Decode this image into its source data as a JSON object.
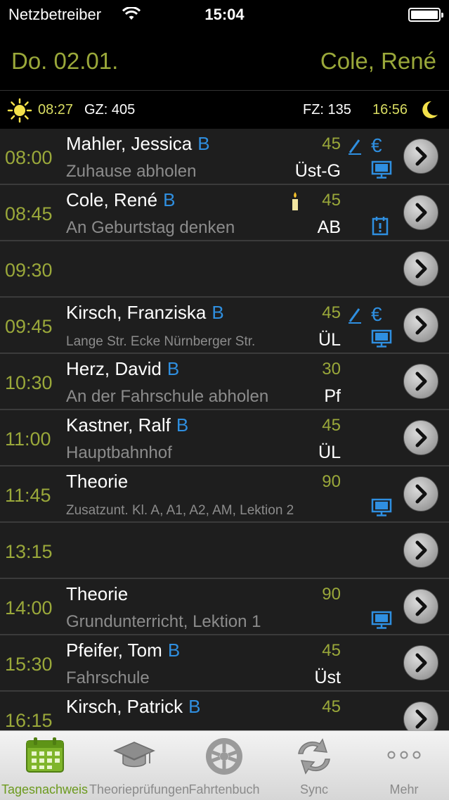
{
  "status": {
    "carrier": "Netzbetreiber",
    "time": "15:04"
  },
  "header": {
    "date": "Do. 02.01.",
    "instructor": "Cole, René"
  },
  "sunbar": {
    "sunrise": "08:27",
    "gz": "GZ: 405",
    "fz": "FZ: 135",
    "sunset": "16:56"
  },
  "rows": [
    {
      "time": "08:00",
      "name": "Mahler, Jessica",
      "class": "B",
      "sub": "Zuhause abholen",
      "dur": "45",
      "code": "Üst-G"
    },
    {
      "time": "08:45",
      "name": "Cole, René",
      "class": "B",
      "sub": "An Geburtstag denken",
      "dur": "45",
      "code": "AB"
    },
    {
      "time": "09:30",
      "name": "",
      "class": "",
      "sub": "",
      "dur": "",
      "code": ""
    },
    {
      "time": "09:45",
      "name": "Kirsch, Franziska",
      "class": "B",
      "sub": "Lange Str. Ecke Nürnberger Str.",
      "dur": "45",
      "code": "ÜL"
    },
    {
      "time": "10:30",
      "name": "Herz, David",
      "class": "B",
      "sub": "An der Fahrschule abholen",
      "dur": "30",
      "code": "Pf"
    },
    {
      "time": "11:00",
      "name": "Kastner, Ralf",
      "class": "B",
      "sub": "Hauptbahnhof",
      "dur": "45",
      "code": "ÜL"
    },
    {
      "time": "11:45",
      "name": "Theorie",
      "class": "",
      "sub": "Zusatzunt. Kl. A, A1, A2, AM, Lektion 2",
      "dur": "90",
      "code": ""
    },
    {
      "time": "13:15",
      "name": "",
      "class": "",
      "sub": "",
      "dur": "",
      "code": ""
    },
    {
      "time": "14:00",
      "name": "Theorie",
      "class": "",
      "sub": "Grundunterricht, Lektion 1",
      "dur": "90",
      "code": ""
    },
    {
      "time": "15:30",
      "name": "Pfeifer, Tom",
      "class": "B",
      "sub": "Fahrschule",
      "dur": "45",
      "code": "Üst"
    },
    {
      "time": "16:15",
      "name": "Kirsch, Patrick",
      "class": "B",
      "sub": "",
      "dur": "45",
      "code": ""
    }
  ],
  "tabs": [
    {
      "label": "Tagesnachweis",
      "icon": "calendar-icon"
    },
    {
      "label": "Theorieprüfungen",
      "icon": "graduation-cap-icon"
    },
    {
      "label": "Fahrtenbuch",
      "icon": "wheel-icon"
    },
    {
      "label": "Sync",
      "icon": "sync-icon"
    },
    {
      "label": "Mehr",
      "icon": "more-icon"
    }
  ],
  "colors": {
    "accent_green": "#9aa83a",
    "class_blue": "#2f8fe0",
    "tab_active": "#6c9a1e"
  }
}
